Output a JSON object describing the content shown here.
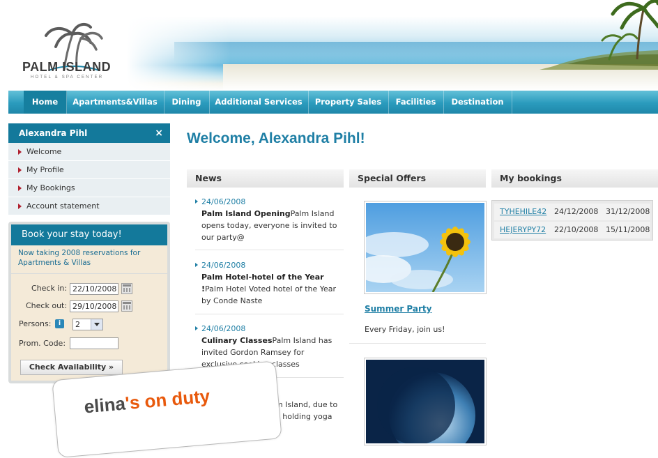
{
  "brand": {
    "name": "PALM ISLAND",
    "tagline": "HOTEL & SPA CENTER"
  },
  "nav": {
    "items": [
      {
        "label": "Home",
        "active": true
      },
      {
        "label": "Apartments&Villas"
      },
      {
        "label": "Dining"
      },
      {
        "label": "Additional Services"
      },
      {
        "label": "Property Sales"
      },
      {
        "label": "Facilities"
      },
      {
        "label": "Destination"
      }
    ]
  },
  "user_panel": {
    "name": "Alexandra Pihl",
    "close": "×",
    "menu": [
      "Welcome",
      "My Profile",
      "My Bookings",
      "Account statement"
    ]
  },
  "booking": {
    "title": "Book your stay today!",
    "note": "Now taking 2008 reservations for Apartments & Villas",
    "checkin_label": "Check in:",
    "checkin_value": "22/10/2008",
    "checkout_label": "Check out:",
    "checkout_value": "29/10/2008",
    "persons_label": "Persons:",
    "persons_value": "2",
    "promo_label": "Prom. Code:",
    "promo_value": "",
    "button": "Check Availability »"
  },
  "main": {
    "welcome": "Welcome, Alexandra Pihl!",
    "news_title": "News",
    "offers_title": "Special Offers",
    "bookings_title": "My bookings"
  },
  "news": [
    {
      "date": "24/06/2008",
      "title": "Palm Island Opening",
      "body": "Palm Island opens today, everyone is invited to our party@"
    },
    {
      "date": "24/06/2008",
      "title": "Palm Hotel-hotel of the Year !",
      "body": "Palm Hotel Voted hotel of the Year by Conde Naste"
    },
    {
      "date": "24/06/2008",
      "title": "Culinary Classes",
      "body": "Palm Island has invited Gordon Ramsey for exclusive cooking classes"
    },
    {
      "partial1": "m Island, due to",
      "partial2": "e holding yoga"
    }
  ],
  "offers": [
    {
      "title": "Summer Party",
      "text": "Every Friday, join us!"
    }
  ],
  "bookings": [
    {
      "code": "TYHEHILE42",
      "from": "24/12/2008",
      "to": "31/12/2008"
    },
    {
      "code": "HEJERYPY72",
      "from": "22/10/2008",
      "to": "15/11/2008"
    }
  ],
  "overlay": {
    "word1": "elina",
    "word2": "'s on duty"
  },
  "icons": {
    "close": "close-icon",
    "menu_arrow": "triangle-right-icon",
    "calendar": "calendar-icon",
    "info": "info-icon",
    "dropdown": "chevron-down-icon"
  },
  "colors": {
    "primary": "#1f7fa5",
    "nav": "#2a9bbd",
    "accent": "#b0202e",
    "badge": "#e8590c"
  }
}
